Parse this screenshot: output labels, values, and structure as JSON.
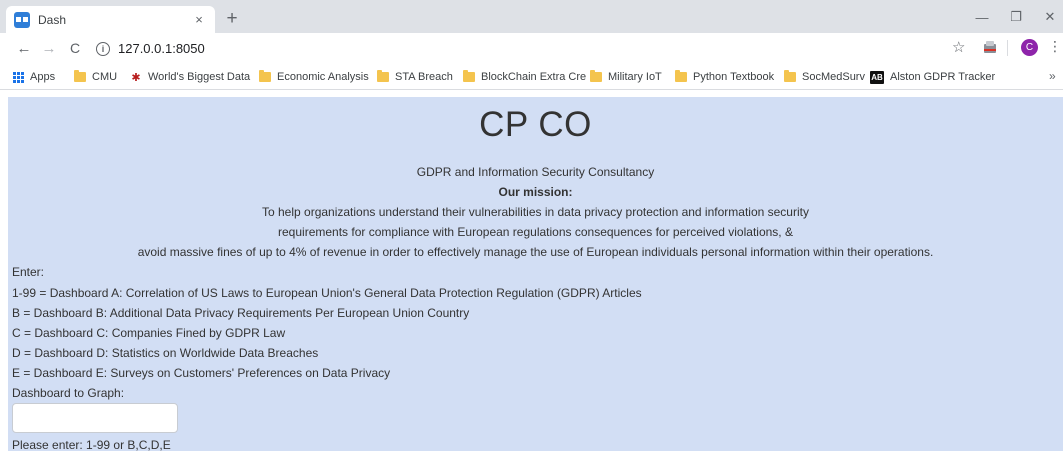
{
  "browser": {
    "tab": {
      "title": "Dash",
      "close": "×"
    },
    "new_tab": "+",
    "window": {
      "minimize": "—",
      "restore": "❐",
      "close": "✕"
    },
    "nav": {
      "back": "←",
      "forward": "→",
      "reload": "C"
    },
    "url": "127.0.0.1:8050",
    "star": "☆",
    "menu": "⋮",
    "profile_initial": "C",
    "bookmarks_more": "»",
    "bookmarks": [
      {
        "label": "Apps",
        "icon": "apps-grid-icon"
      },
      {
        "label": "CMU",
        "icon": "folder-icon"
      },
      {
        "label": "World's Biggest Data",
        "icon": "bug-icon"
      },
      {
        "label": "Economic Analysis",
        "icon": "folder-icon"
      },
      {
        "label": "STA Breach",
        "icon": "folder-icon"
      },
      {
        "label": "BlockChain Extra Cre",
        "icon": "folder-icon"
      },
      {
        "label": "Military IoT",
        "icon": "folder-icon"
      },
      {
        "label": "Python Textbook",
        "icon": "folder-icon"
      },
      {
        "label": "SocMedSurv",
        "icon": "folder-icon"
      },
      {
        "label": "Alston GDPR Tracker",
        "icon": "ab-badge-icon",
        "badge": "AB"
      }
    ]
  },
  "page": {
    "background": "#d2def4",
    "brand": "CP CO",
    "tagline": "GDPR and Information Security Consultancy",
    "mission_heading": "Our mission:",
    "mission_lines": [
      "To help organizations understand their vulnerabilities in data privacy protection and information security",
      "requirements for compliance with European regulations consequences for perceived violations, &",
      "avoid massive fines of up to 4% of revenue in order to effectively manage the use of European individuals personal information within their operations."
    ],
    "enter_label": "Enter:",
    "options": [
      "1-99 = Dashboard A: Correlation of US Laws to European Union's General Data Protection Regulation (GDPR) Articles",
      "B = Dashboard B: Additional Data Privacy Requirements Per European Union Country",
      "C = Dashboard C: Companies Fined by GDPR Law",
      "D = Dashboard D: Statistics on Worldwide Data Breaches",
      "E = Dashboard E: Surveys on Customers' Preferences on Data Privacy"
    ],
    "input_label": "Dashboard to Graph:",
    "input_value": "",
    "hint": "Please enter: 1-99 or B,C,D,E"
  }
}
